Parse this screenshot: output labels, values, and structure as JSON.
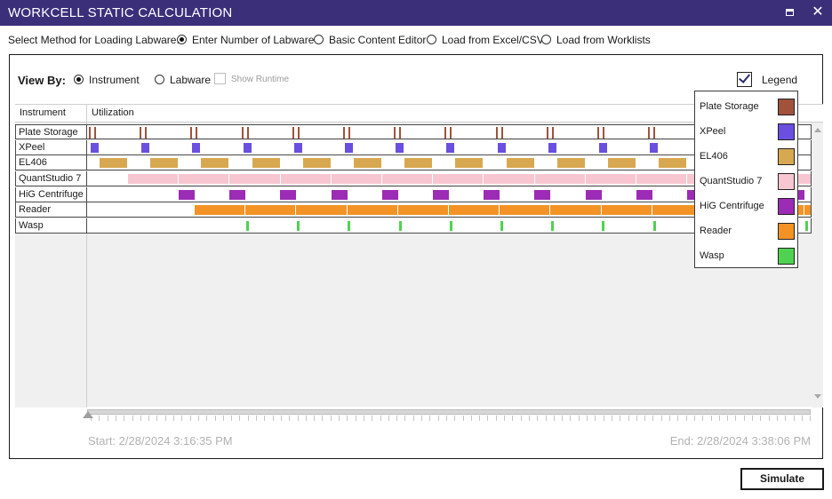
{
  "window": {
    "title": "WORKCELL STATIC CALCULATION",
    "maximize_icon": "maximize-icon",
    "close_icon": "close-icon",
    "close_glyph": "✕"
  },
  "method": {
    "label": "Select Method for Loading Labware:",
    "options": [
      {
        "label": "Enter Number of Labware",
        "selected": true
      },
      {
        "label": "Basic Content Editor",
        "selected": false
      },
      {
        "label": "Load from Excel/CSV",
        "selected": false
      },
      {
        "label": "Load from Worklists",
        "selected": false
      }
    ]
  },
  "view_by": {
    "label": "View By:",
    "options": [
      {
        "label": "Instrument",
        "selected": true
      },
      {
        "label": "Labware",
        "selected": false
      }
    ],
    "show_runtime": {
      "label": "Show Runtime",
      "checked": false,
      "enabled": false
    }
  },
  "legend_toggle": {
    "label": "Legend",
    "checked": true
  },
  "grid": {
    "col_instrument": "Instrument",
    "col_utilization": "Utilization",
    "rows": [
      {
        "name": "Plate Storage"
      },
      {
        "name": "XPeel"
      },
      {
        "name": "EL406"
      },
      {
        "name": "QuantStudio 7"
      },
      {
        "name": "HiG Centrifuge"
      },
      {
        "name": "Reader"
      },
      {
        "name": "Wasp"
      }
    ]
  },
  "legend": {
    "items": [
      {
        "label": "Plate Storage",
        "color": "#a0523d"
      },
      {
        "label": "XPeel",
        "color": "#6a4fe0"
      },
      {
        "label": "EL406",
        "color": "#d8a850"
      },
      {
        "label": "QuantStudio 7",
        "color": "#f8c6d0"
      },
      {
        "label": "HiG Centrifuge",
        "color": "#9c2bb5"
      },
      {
        "label": "Reader",
        "color": "#f39325"
      },
      {
        "label": "Wasp",
        "color": "#4fd24f"
      }
    ]
  },
  "timeline": {
    "start": "Start: 2/28/2024 3:16:35 PM",
    "end": "End: 2/28/2024 3:38:06 PM"
  },
  "simulate_label": "Simulate"
}
